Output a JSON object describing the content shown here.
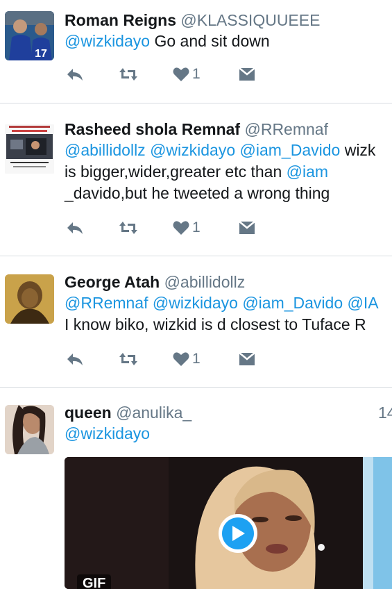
{
  "tweets": [
    {
      "name": "Roman Reigns",
      "handle": "@KLASSIQUUEEE",
      "mentions": "@wizkidayo",
      "text": " Go and sit down",
      "likes": "1"
    },
    {
      "name": "Rasheed shola Remnaf",
      "handle": "@RRemnaf",
      "line1_mentions": "@abillidollz @wizkidayo @iam_Davido",
      "line1_text": " wizk",
      "line2_text": "is bigger,wider,greater etc than ",
      "line2_mention": "@iam",
      "line3_text": "_davido,but he tweeted a wrong thing",
      "likes": "1"
    },
    {
      "name": "George Atah",
      "handle": "@abillidollz",
      "line1_mentions": "@RRemnaf @wizkidayo @iam_Davido @IA",
      "line2_text": "I know biko, wizkid is d closest to Tuface R",
      "likes": "1"
    },
    {
      "name": "queen",
      "handle": "@anulika_",
      "time": "14",
      "mentions": "@wizkidayo",
      "media_badge": "GIF"
    }
  ],
  "icons": {
    "reply": "reply-icon",
    "retweet": "retweet-icon",
    "like": "heart-icon",
    "dm": "direct-message-icon",
    "play": "play-icon"
  },
  "colors": {
    "mention": "#1b95e0",
    "action_icon": "#657786",
    "divider": "#d8dde1",
    "play_button": "#1da1f2"
  }
}
